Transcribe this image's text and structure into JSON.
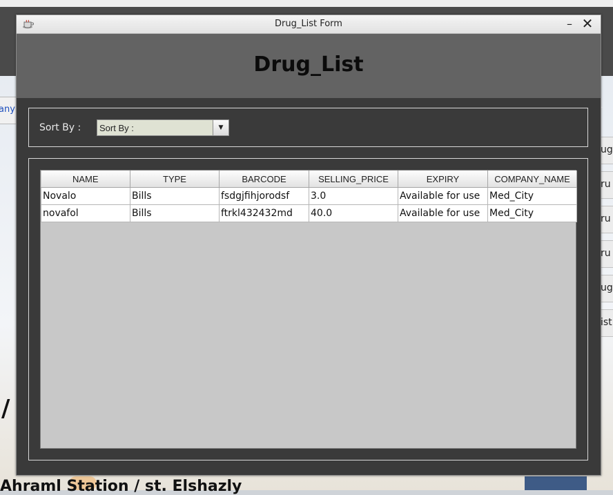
{
  "background_app": {
    "left_tab_text": "any",
    "slash_text": "/",
    "bottom_text": "Ahraml Station / st. Elshazly",
    "right_buttons": [
      "ug",
      "ru",
      "ru",
      "ru",
      "ug",
      "ist"
    ]
  },
  "dialog": {
    "window_title": "Drug_List Form",
    "minimize_glyph": "–",
    "close_glyph": "✕",
    "heading": "Drug_List",
    "sort": {
      "label": "Sort By :",
      "selected_value": "Sort By :",
      "arrow_glyph": "▼"
    },
    "table": {
      "columns": [
        "NAME",
        "TYPE",
        "BARCODE",
        "SELLING_PRICE",
        "EXPIRY",
        "COMPANY_NAME"
      ],
      "rows": [
        [
          "Novalo",
          "Bills",
          "fsdgjfihjorodsf",
          "3.0",
          "Available for use",
          "Med_City"
        ],
        [
          "novafol",
          "Bills",
          "ftrkl432432md",
          "40.0",
          "Available for use",
          "Med_City"
        ]
      ]
    }
  }
}
